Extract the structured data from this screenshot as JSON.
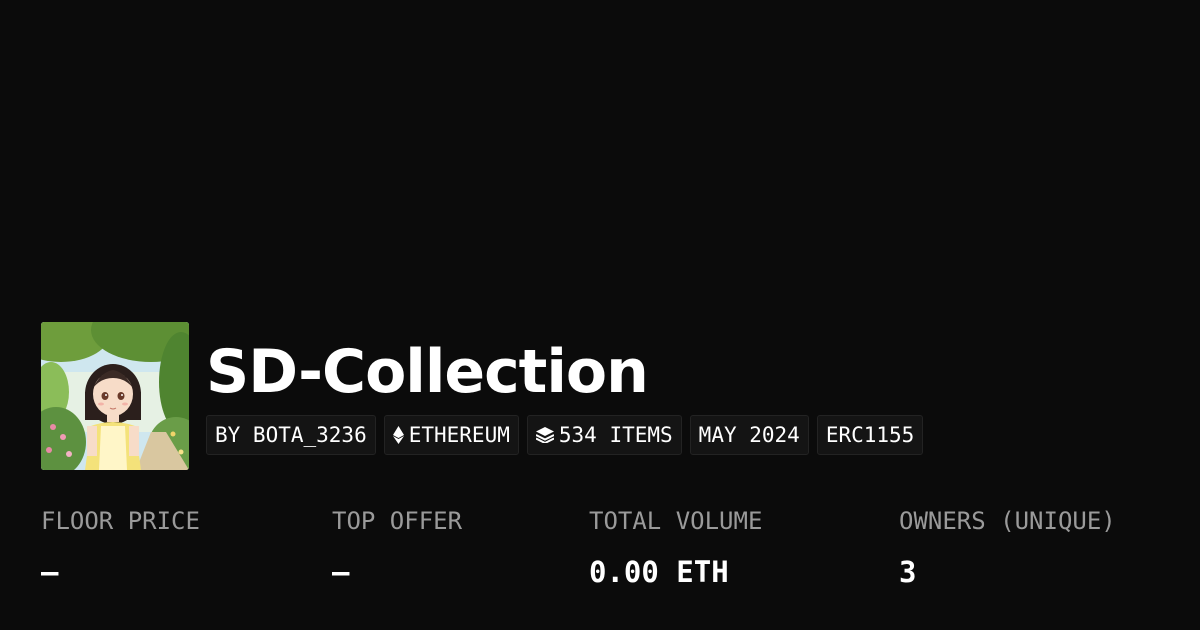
{
  "collection": {
    "title": "SD-Collection"
  },
  "badges": {
    "creator": "BY BOTA_3236",
    "chain": "ETHEREUM",
    "items": "534 ITEMS",
    "date": "MAY 2024",
    "standard": "ERC1155"
  },
  "stats": {
    "floor_price": {
      "label": "FLOOR PRICE",
      "value": "—"
    },
    "top_offer": {
      "label": "TOP OFFER",
      "value": "—"
    },
    "total_volume": {
      "label": "TOTAL VOLUME",
      "value": "0.00 ETH"
    },
    "owners": {
      "label": "OWNERS (UNIQUE)",
      "value": "3"
    }
  },
  "icons": {
    "chain": "ethereum-icon",
    "items": "layers-icon"
  },
  "colors": {
    "background": "#0b0b0b",
    "badge_background": "#141414",
    "label_gray": "#9a9a9a",
    "text": "#ffffff"
  }
}
